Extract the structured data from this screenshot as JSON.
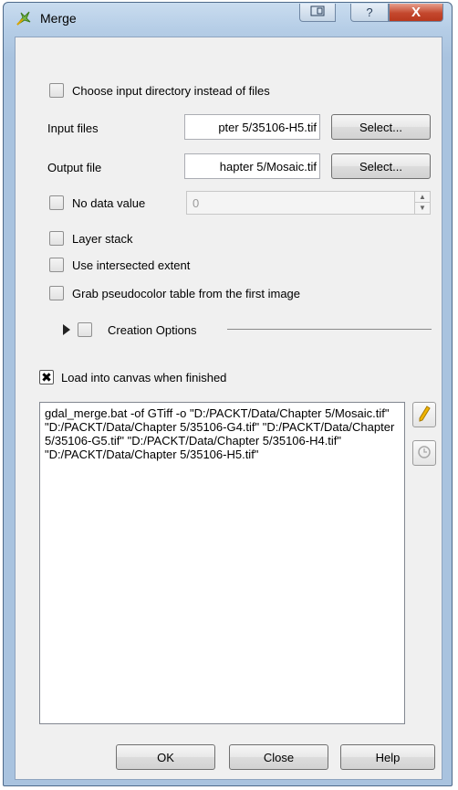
{
  "window": {
    "title": "Merge",
    "help_glyph": "?",
    "close_glyph": "X"
  },
  "options": {
    "choose_dir_label": "Choose input directory instead of files",
    "input_files_label": "Input files",
    "input_files_value": "pter 5/35106-H5.tif",
    "input_select_label": "Select...",
    "output_file_label": "Output file",
    "output_file_value": "hapter 5/Mosaic.tif",
    "output_select_label": "Select...",
    "no_data_label": "No data value",
    "no_data_value": "0",
    "layer_stack_label": "Layer stack",
    "intersected_label": "Use intersected extent",
    "pseudocolor_label": "Grab pseudocolor table from the first image",
    "creation_options_label": "Creation Options",
    "load_canvas_label": "Load into canvas when finished",
    "load_canvas_checked": true
  },
  "command": {
    "text": "gdal_merge.bat -of GTiff -o \"D:/PACKT/Data/Chapter 5/Mosaic.tif\" \"D:/PACKT/Data/Chapter 5/35106-G4.tif\" \"D:/PACKT/Data/Chapter 5/35106-G5.tif\" \"D:/PACKT/Data/Chapter 5/35106-H4.tif\" \"D:/PACKT/Data/Chapter 5/35106-H5.tif\""
  },
  "footer": {
    "ok_label": "OK",
    "close_label": "Close",
    "help_label": "Help"
  },
  "colors": {
    "title_gradient": "#b5cde6",
    "close_button": "#c4482d",
    "client_bg": "#f0f0f0",
    "edit_pencil": "#f0b400"
  }
}
